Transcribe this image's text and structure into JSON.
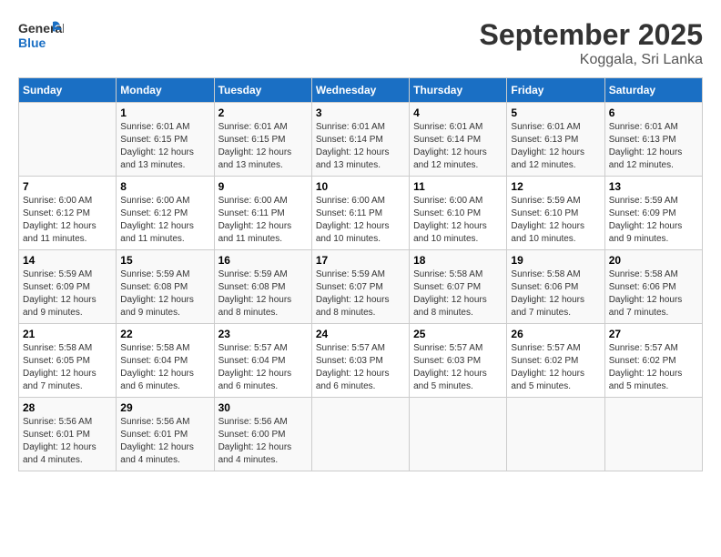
{
  "logo": {
    "line1": "General",
    "line2": "Blue"
  },
  "title": "September 2025",
  "subtitle": "Koggala, Sri Lanka",
  "days_of_week": [
    "Sunday",
    "Monday",
    "Tuesday",
    "Wednesday",
    "Thursday",
    "Friday",
    "Saturday"
  ],
  "weeks": [
    [
      {
        "day": "",
        "info": ""
      },
      {
        "day": "1",
        "info": "Sunrise: 6:01 AM\nSunset: 6:15 PM\nDaylight: 12 hours\nand 13 minutes."
      },
      {
        "day": "2",
        "info": "Sunrise: 6:01 AM\nSunset: 6:15 PM\nDaylight: 12 hours\nand 13 minutes."
      },
      {
        "day": "3",
        "info": "Sunrise: 6:01 AM\nSunset: 6:14 PM\nDaylight: 12 hours\nand 13 minutes."
      },
      {
        "day": "4",
        "info": "Sunrise: 6:01 AM\nSunset: 6:14 PM\nDaylight: 12 hours\nand 12 minutes."
      },
      {
        "day": "5",
        "info": "Sunrise: 6:01 AM\nSunset: 6:13 PM\nDaylight: 12 hours\nand 12 minutes."
      },
      {
        "day": "6",
        "info": "Sunrise: 6:01 AM\nSunset: 6:13 PM\nDaylight: 12 hours\nand 12 minutes."
      }
    ],
    [
      {
        "day": "7",
        "info": "Sunrise: 6:00 AM\nSunset: 6:12 PM\nDaylight: 12 hours\nand 11 minutes."
      },
      {
        "day": "8",
        "info": "Sunrise: 6:00 AM\nSunset: 6:12 PM\nDaylight: 12 hours\nand 11 minutes."
      },
      {
        "day": "9",
        "info": "Sunrise: 6:00 AM\nSunset: 6:11 PM\nDaylight: 12 hours\nand 11 minutes."
      },
      {
        "day": "10",
        "info": "Sunrise: 6:00 AM\nSunset: 6:11 PM\nDaylight: 12 hours\nand 10 minutes."
      },
      {
        "day": "11",
        "info": "Sunrise: 6:00 AM\nSunset: 6:10 PM\nDaylight: 12 hours\nand 10 minutes."
      },
      {
        "day": "12",
        "info": "Sunrise: 5:59 AM\nSunset: 6:10 PM\nDaylight: 12 hours\nand 10 minutes."
      },
      {
        "day": "13",
        "info": "Sunrise: 5:59 AM\nSunset: 6:09 PM\nDaylight: 12 hours\nand 9 minutes."
      }
    ],
    [
      {
        "day": "14",
        "info": "Sunrise: 5:59 AM\nSunset: 6:09 PM\nDaylight: 12 hours\nand 9 minutes."
      },
      {
        "day": "15",
        "info": "Sunrise: 5:59 AM\nSunset: 6:08 PM\nDaylight: 12 hours\nand 9 minutes."
      },
      {
        "day": "16",
        "info": "Sunrise: 5:59 AM\nSunset: 6:08 PM\nDaylight: 12 hours\nand 8 minutes."
      },
      {
        "day": "17",
        "info": "Sunrise: 5:59 AM\nSunset: 6:07 PM\nDaylight: 12 hours\nand 8 minutes."
      },
      {
        "day": "18",
        "info": "Sunrise: 5:58 AM\nSunset: 6:07 PM\nDaylight: 12 hours\nand 8 minutes."
      },
      {
        "day": "19",
        "info": "Sunrise: 5:58 AM\nSunset: 6:06 PM\nDaylight: 12 hours\nand 7 minutes."
      },
      {
        "day": "20",
        "info": "Sunrise: 5:58 AM\nSunset: 6:06 PM\nDaylight: 12 hours\nand 7 minutes."
      }
    ],
    [
      {
        "day": "21",
        "info": "Sunrise: 5:58 AM\nSunset: 6:05 PM\nDaylight: 12 hours\nand 7 minutes."
      },
      {
        "day": "22",
        "info": "Sunrise: 5:58 AM\nSunset: 6:04 PM\nDaylight: 12 hours\nand 6 minutes."
      },
      {
        "day": "23",
        "info": "Sunrise: 5:57 AM\nSunset: 6:04 PM\nDaylight: 12 hours\nand 6 minutes."
      },
      {
        "day": "24",
        "info": "Sunrise: 5:57 AM\nSunset: 6:03 PM\nDaylight: 12 hours\nand 6 minutes."
      },
      {
        "day": "25",
        "info": "Sunrise: 5:57 AM\nSunset: 6:03 PM\nDaylight: 12 hours\nand 5 minutes."
      },
      {
        "day": "26",
        "info": "Sunrise: 5:57 AM\nSunset: 6:02 PM\nDaylight: 12 hours\nand 5 minutes."
      },
      {
        "day": "27",
        "info": "Sunrise: 5:57 AM\nSunset: 6:02 PM\nDaylight: 12 hours\nand 5 minutes."
      }
    ],
    [
      {
        "day": "28",
        "info": "Sunrise: 5:56 AM\nSunset: 6:01 PM\nDaylight: 12 hours\nand 4 minutes."
      },
      {
        "day": "29",
        "info": "Sunrise: 5:56 AM\nSunset: 6:01 PM\nDaylight: 12 hours\nand 4 minutes."
      },
      {
        "day": "30",
        "info": "Sunrise: 5:56 AM\nSunset: 6:00 PM\nDaylight: 12 hours\nand 4 minutes."
      },
      {
        "day": "",
        "info": ""
      },
      {
        "day": "",
        "info": ""
      },
      {
        "day": "",
        "info": ""
      },
      {
        "day": "",
        "info": ""
      }
    ]
  ]
}
